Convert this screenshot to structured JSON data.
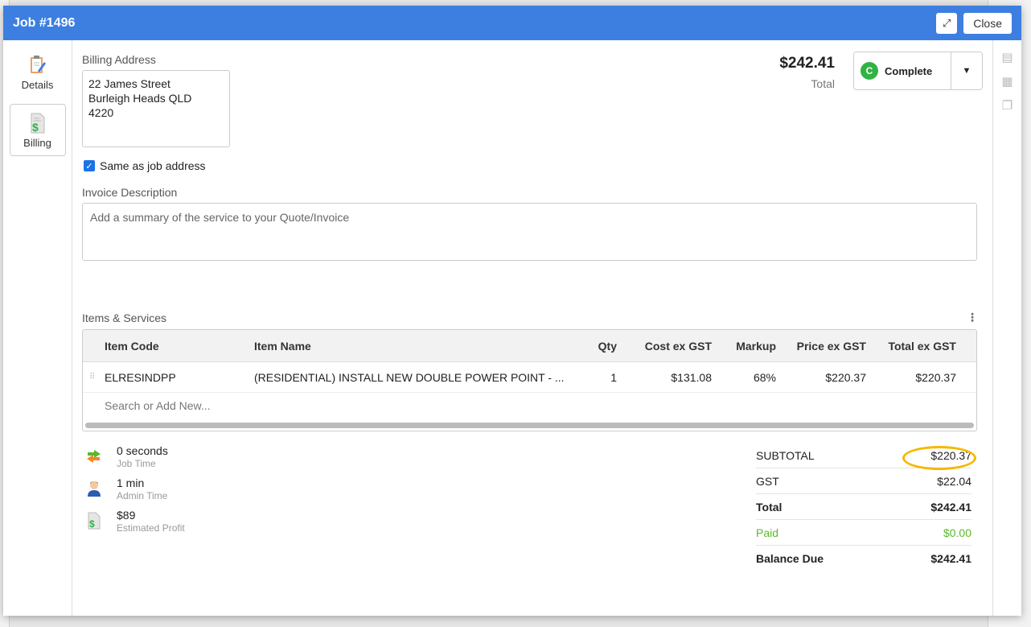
{
  "modal": {
    "title": "Job #1496",
    "close_label": "Close"
  },
  "nav": {
    "details_label": "Details",
    "billing_label": "Billing"
  },
  "billing": {
    "address_label": "Billing Address",
    "address_lines": [
      "22 James Street",
      "Burleigh Heads QLD",
      "4220"
    ],
    "same_as_job_label": "Same as job address",
    "same_as_job_checked": true,
    "invoice_label": "Invoice Description",
    "invoice_placeholder": "Add a summary of the service to your Quote/Invoice"
  },
  "header_summary": {
    "total_amount": "$242.41",
    "total_label": "Total",
    "status_letter": "C",
    "status_label": "Complete",
    "status_color": "#2fb344"
  },
  "items": {
    "section_label": "Items & Services",
    "columns": [
      "Item Code",
      "Item Name",
      "Qty",
      "Cost ex GST",
      "Markup",
      "Price ex GST",
      "Total ex GST"
    ],
    "rows": [
      {
        "code": "ELRESINDPP",
        "name": "(RESIDENTIAL) INSTALL NEW DOUBLE POWER POINT - ...",
        "qty": "1",
        "cost": "$131.08",
        "markup": "68%",
        "price": "$220.37",
        "total": "$220.37"
      }
    ],
    "search_placeholder": "Search or Add New..."
  },
  "metrics": {
    "job_time": "0 seconds",
    "job_time_label": "Job Time",
    "admin_time": "1 min",
    "admin_time_label": "Admin Time",
    "profit": "$89",
    "profit_label": "Estimated Profit"
  },
  "summary": {
    "subtotal_label": "SUBTOTAL",
    "subtotal": "$220.37",
    "gst_label": "GST",
    "gst": "$22.04",
    "total_label": "Total",
    "total": "$242.41",
    "paid_label": "Paid",
    "paid": "$0.00",
    "balance_label": "Balance Due",
    "balance": "$242.41",
    "highlight_color": "#f5b800"
  },
  "colors": {
    "header_blue": "#3d7fe0",
    "paid_green": "#5bb82a"
  }
}
